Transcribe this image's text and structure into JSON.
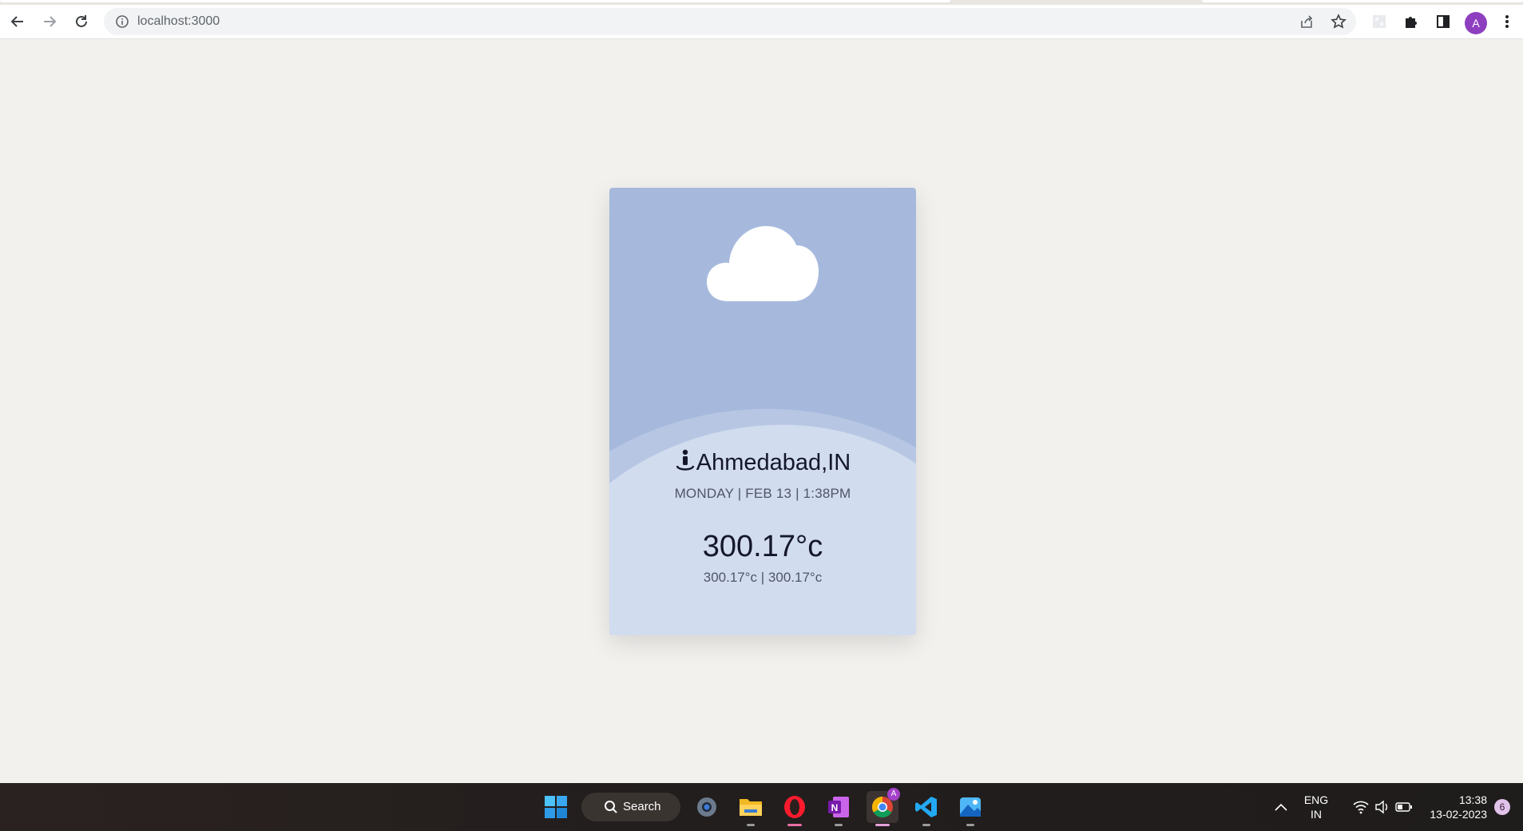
{
  "browser": {
    "url": "localhost:3000",
    "profile_initial": "A",
    "icons": [
      "back-icon",
      "forward-icon",
      "reload-icon",
      "info-icon",
      "share-icon",
      "star-icon",
      "extension-icon",
      "puzzle-icon",
      "side-panel-icon",
      "menu-icon"
    ]
  },
  "weather": {
    "condition_icon": "cloud-icon",
    "location": "Ahmedabad,IN",
    "datetime": "MONDAY | FEB 13 | 1:38PM",
    "temperature": "300.17°c",
    "min_max": "300.17°c | 300.17°c",
    "colors": {
      "card_top": "#a6b9dd",
      "card_bottom": "#d1dcee",
      "text": "#14172a"
    }
  },
  "taskbar": {
    "search_label": "Search",
    "apps": [
      "windows-start-icon",
      "settings-icon",
      "file-explorer-icon",
      "opera-icon",
      "onenote-icon",
      "chrome-icon",
      "vscode-icon",
      "photos-icon"
    ],
    "chrome_badge": "A",
    "language_line1": "ENG",
    "language_line2": "IN",
    "time": "13:38",
    "date": "13-02-2023",
    "notification_count": "6"
  }
}
